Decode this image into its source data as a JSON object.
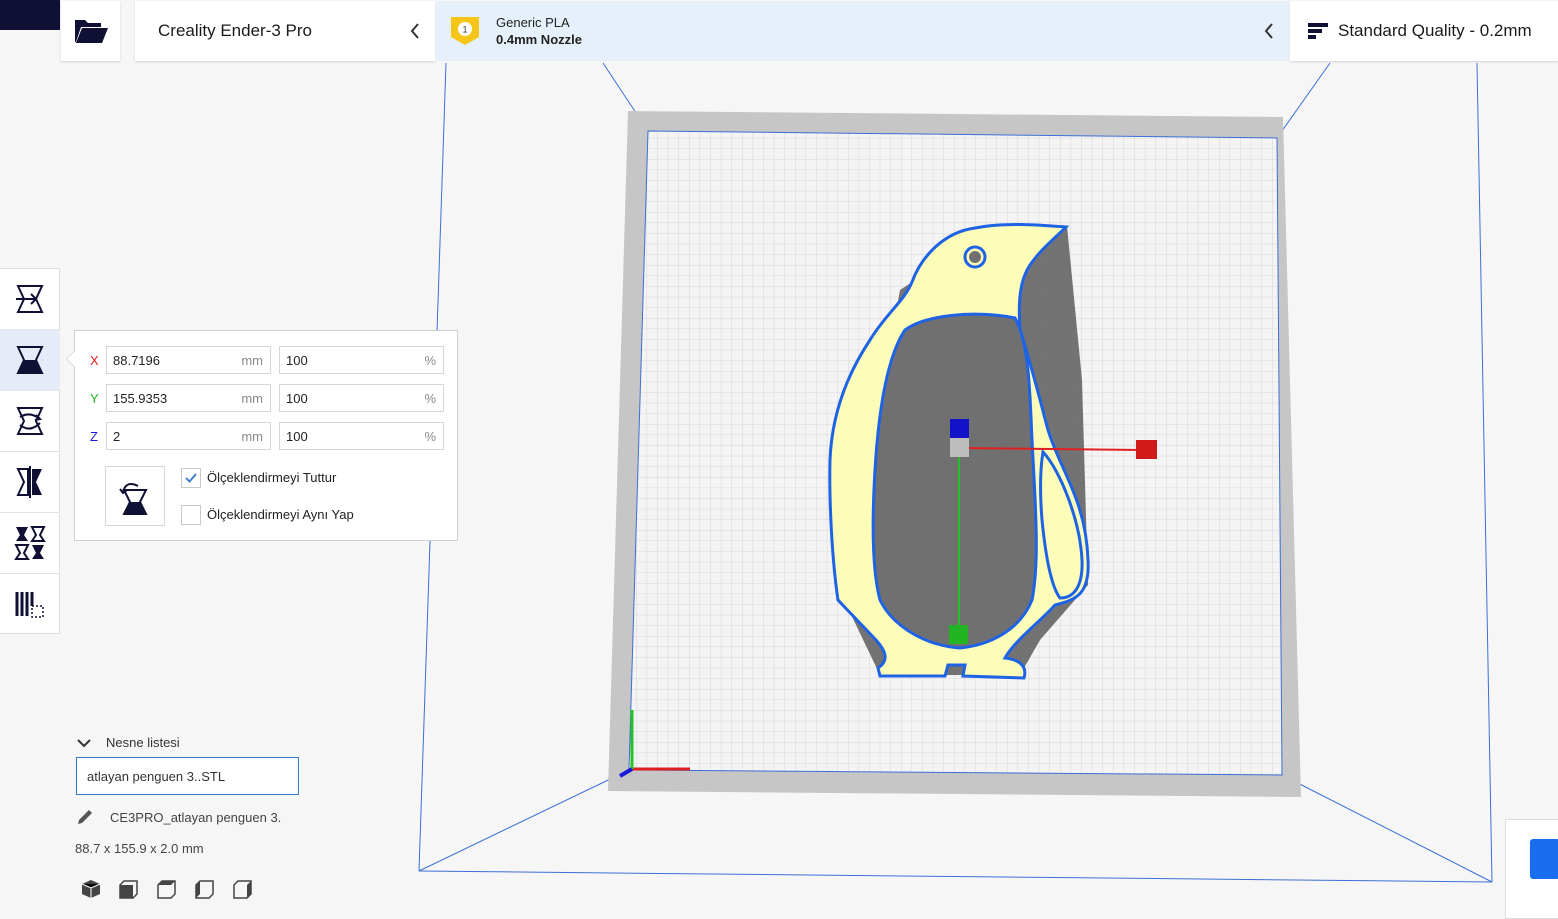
{
  "header": {
    "printer": "Creality Ender-3 Pro",
    "material": {
      "badge": "1",
      "name": "Generic PLA",
      "nozzle": "0.4mm Nozzle"
    },
    "quality": "Standard Quality - 0.2mm"
  },
  "toolbar": {
    "tools": [
      "move-tool",
      "scale-tool",
      "rotate-tool",
      "mirror-tool",
      "per-model-settings-tool",
      "support-blocker-tool"
    ],
    "active": "scale-tool"
  },
  "scale_panel": {
    "x": {
      "label": "X",
      "value": "88.7196",
      "unit": "mm",
      "percent": "100",
      "percent_unit": "%"
    },
    "y": {
      "label": "Y",
      "value": "155.9353",
      "unit": "mm",
      "percent": "100",
      "percent_unit": "%"
    },
    "z": {
      "label": "Z",
      "value": "2",
      "unit": "mm",
      "percent": "100",
      "percent_unit": "%"
    },
    "snap_scaling": {
      "label": "Ölçeklendirmeyi Tuttur",
      "checked": true
    },
    "uniform_scaling": {
      "label": "Ölçeklendirmeyi Aynı Yap",
      "checked": false
    }
  },
  "object_list": {
    "title": "Nesne listesi",
    "selected": "atlayan penguen 3..STL",
    "job_name": "CE3PRO_atlayan penguen 3.",
    "dimensions": "88.7 x 155.9 x 2.0 mm"
  },
  "view_buttons": [
    "3d-view",
    "front-view",
    "top-view",
    "left-view",
    "right-view"
  ],
  "colors": {
    "accent": "#196ef0",
    "model_fill": "#fbfdb8",
    "model_outline": "#1e62e6",
    "axis_x": "#e02020",
    "axis_y": "#22c322",
    "axis_z": "#1a1ad6"
  }
}
